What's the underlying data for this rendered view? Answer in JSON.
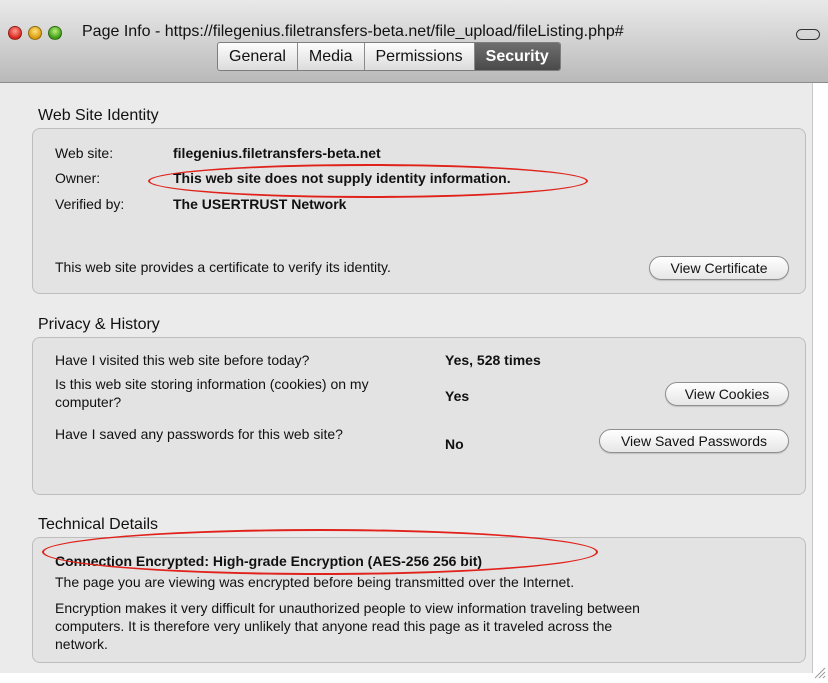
{
  "window": {
    "title": "Page Info - https://filegenius.filetransfers-beta.net/file_upload/fileListing.php#",
    "tabs": [
      "General",
      "Media",
      "Permissions",
      "Security"
    ],
    "active_tab": "Security"
  },
  "identity": {
    "heading": "Web Site Identity",
    "website_label": "Web site:",
    "website_value": "filegenius.filetransfers-beta.net",
    "owner_label": "Owner:",
    "owner_value": "This web site does not supply identity information.",
    "verified_label": "Verified by:",
    "verified_value": "The USERTRUST Network",
    "certificate_note": "This web site provides a certificate to verify its identity.",
    "view_certificate_label": "View Certificate"
  },
  "privacy": {
    "heading": "Privacy & History",
    "q1": "Have I visited this web site before today?",
    "a1": "Yes, 528 times",
    "q2_line1": "Is this web site storing information (cookies) on my",
    "q2_line2": "computer?",
    "a2": "Yes",
    "view_cookies_label": "View Cookies",
    "q3": "Have I saved any passwords for this web site?",
    "a3": "No",
    "view_passwords_label": "View Saved Passwords"
  },
  "technical": {
    "heading": "Technical Details",
    "encryption_title": "Connection Encrypted: High-grade Encryption (AES-256 256 bit)",
    "line1": "The page you are viewing was encrypted before being transmitted over the Internet.",
    "line2a": "Encryption makes it very difficult for unauthorized people to view information traveling between",
    "line2b": "computers. It is therefore very unlikely that anyone read this page as it traveled across the",
    "line2c": "network."
  },
  "colors": {
    "highlight_oval": "#e0221b",
    "active_tab": "#555555"
  }
}
